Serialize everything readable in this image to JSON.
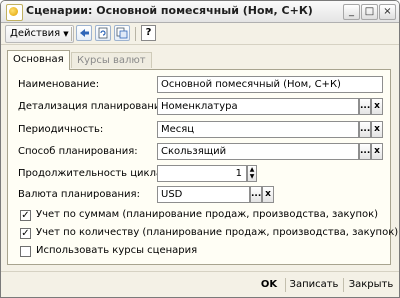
{
  "window": {
    "title": "Сценарии: Основной помесячный (Ном, С+К)",
    "controls": {
      "minimize": "_",
      "maximize": "□",
      "close": "×"
    }
  },
  "toolbar": {
    "actions_label": "Действия",
    "icons": [
      "back-arrow-icon",
      "refresh-page-icon",
      "copy-document-icon",
      "help-icon"
    ],
    "help_label": "?"
  },
  "tabs": [
    {
      "label": "Основная",
      "active": true
    },
    {
      "label": "Курсы валют",
      "active": false
    }
  ],
  "form": {
    "name_label": "Наименование:",
    "name_value": "Основной помесячный (Ном, С+К)",
    "detail_label": "Детализация планирования:",
    "detail_value": "Номенклатура",
    "period_label": "Периодичность:",
    "period_value": "Месяц",
    "method_label": "Способ планирования:",
    "method_value": "Скользящий",
    "cycle_label": "Продолжительность цикла:",
    "cycle_value": "1",
    "currency_label": "Валюта планирования:",
    "currency_value": "USD",
    "select_btn": "...",
    "clear_btn": "x"
  },
  "checkboxes": [
    {
      "label": "Учет по суммам (планирование продаж, производства, закупок)",
      "checked": true
    },
    {
      "label": "Учет по количеству (планирование продаж, производства, закупок)",
      "checked": true
    },
    {
      "label": "Использовать курсы сценария",
      "checked": false
    }
  ],
  "bottom": {
    "ok_label": "OK",
    "save_label": "Записать",
    "close_label": "Закрыть"
  }
}
